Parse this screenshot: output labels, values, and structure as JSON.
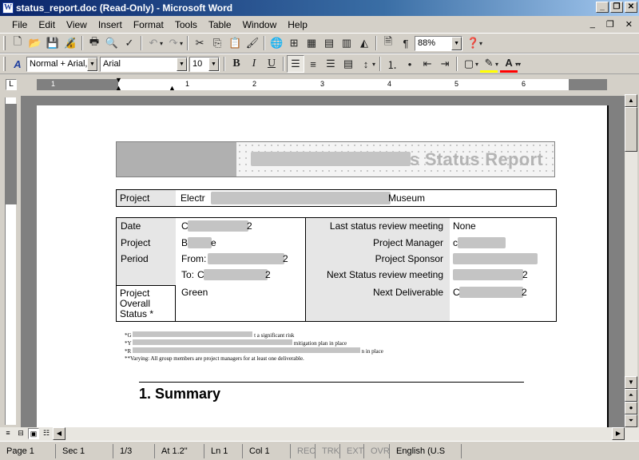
{
  "window": {
    "title": "status_report.doc (Read-Only) - Microsoft Word",
    "app_icon_letter": "W",
    "buttons": [
      "_",
      "❐",
      "✕"
    ]
  },
  "menu": {
    "items": [
      "File",
      "Edit",
      "View",
      "Insert",
      "Format",
      "Tools",
      "Table",
      "Window",
      "Help"
    ],
    "doc_buttons": [
      "_",
      "❐",
      "✕"
    ]
  },
  "standard_toolbar": {
    "zoom": "88%"
  },
  "formatting_toolbar": {
    "style": "Normal + Arial,",
    "font": "Arial",
    "size": "10",
    "bold": "B",
    "italic": "I",
    "underline": "U"
  },
  "ruler": {
    "tab_selector": "L",
    "numbers": [
      "1",
      "1",
      "2",
      "3",
      "4",
      "5",
      "6"
    ]
  },
  "document": {
    "banner_title": "s Status Report",
    "project_label": "Project",
    "project_value_start": "Electr",
    "project_value_end": "Museum",
    "info": {
      "date_label": "Date",
      "date_value_end": "2",
      "date_value_start": "C",
      "project_label": "Project",
      "project_value_start": "B",
      "project_value_end": "e",
      "period_label": "Period",
      "from_label": "From:",
      "from_value_end": "2",
      "to_label": "To:",
      "to_value_start": "C",
      "to_value_end": "2",
      "overall_status_label": "Project Overall Status *",
      "overall_status_value": "Green",
      "last_review_label": "Last status review meeting",
      "last_review_value": "None",
      "manager_label": "Project Manager",
      "manager_value_start": "c",
      "sponsor_label": "Project Sponsor",
      "next_review_label": "Next Status review meeting",
      "next_review_value_end": "2",
      "next_deliverable_label": "Next Deliverable",
      "next_deliverable_value_start": "C",
      "next_deliverable_value_end": "2"
    },
    "legend": [
      "*G",
      "*Y",
      "*R",
      "**Varying: All group members are project managers for at least one deliverable."
    ],
    "legend_fragments": {
      "line1": "t a significant risk",
      "line2": "mitigation plan in place",
      "line3": "n in place"
    },
    "heading": "1.   Summary"
  },
  "statusbar": {
    "page": "Page  1",
    "section": "Sec  1",
    "pages": "1/3",
    "at": "At  1.2\"",
    "line": "Ln  1",
    "col": "Col  1",
    "rec": "REC",
    "trk": "TRK",
    "ext": "EXT",
    "ovr": "OVR",
    "language": "English (U.S"
  }
}
